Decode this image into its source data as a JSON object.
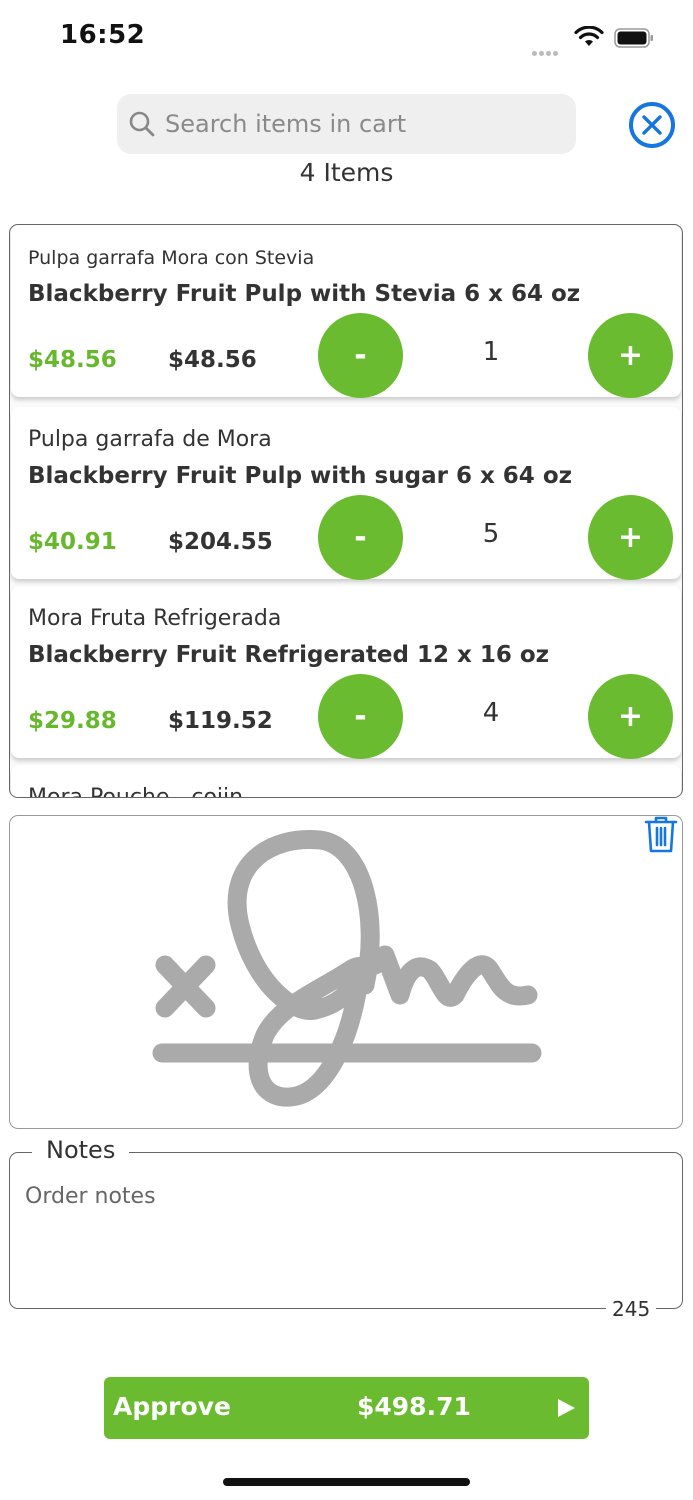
{
  "status_bar": {
    "time": "16:52"
  },
  "search": {
    "placeholder": "Search items in cart"
  },
  "cart": {
    "count_label": "4 Items",
    "items": [
      {
        "name_es": "Pulpa garrafa Mora con Stevia",
        "name_en": "Blackberry Fruit Pulp with Stevia 6 x 64 oz",
        "unit_price": "$48.56",
        "total_price": "$48.56",
        "quantity": "1"
      },
      {
        "name_es": "Pulpa garrafa de Mora",
        "name_en": "Blackberry Fruit Pulp with sugar 6 x 64 oz",
        "unit_price": "$40.91",
        "total_price": "$204.55",
        "quantity": "5"
      },
      {
        "name_es": "Mora Fruta Refrigerada",
        "name_en": "Blackberry Fruit Refrigerated  12 x 16 oz",
        "unit_price": "$29.88",
        "total_price": "$119.52",
        "quantity": "4"
      },
      {
        "name_es": "Mora Pouche - cojin"
      }
    ],
    "minus_label": "-",
    "plus_label": "+"
  },
  "signature": {
    "icon": "signature-icon",
    "clear_icon": "trash-icon"
  },
  "notes": {
    "label": "Notes",
    "placeholder": "Order notes",
    "remaining_chars": "245"
  },
  "approve": {
    "label": "Approve",
    "total": "$498.71",
    "icon": "play-icon"
  },
  "colors": {
    "accent_green": "#6abb2f",
    "price_green": "#68b82e",
    "close_blue": "#1576e0",
    "trash_blue": "#1576e0",
    "signature_gray": "#aaaaaa"
  }
}
